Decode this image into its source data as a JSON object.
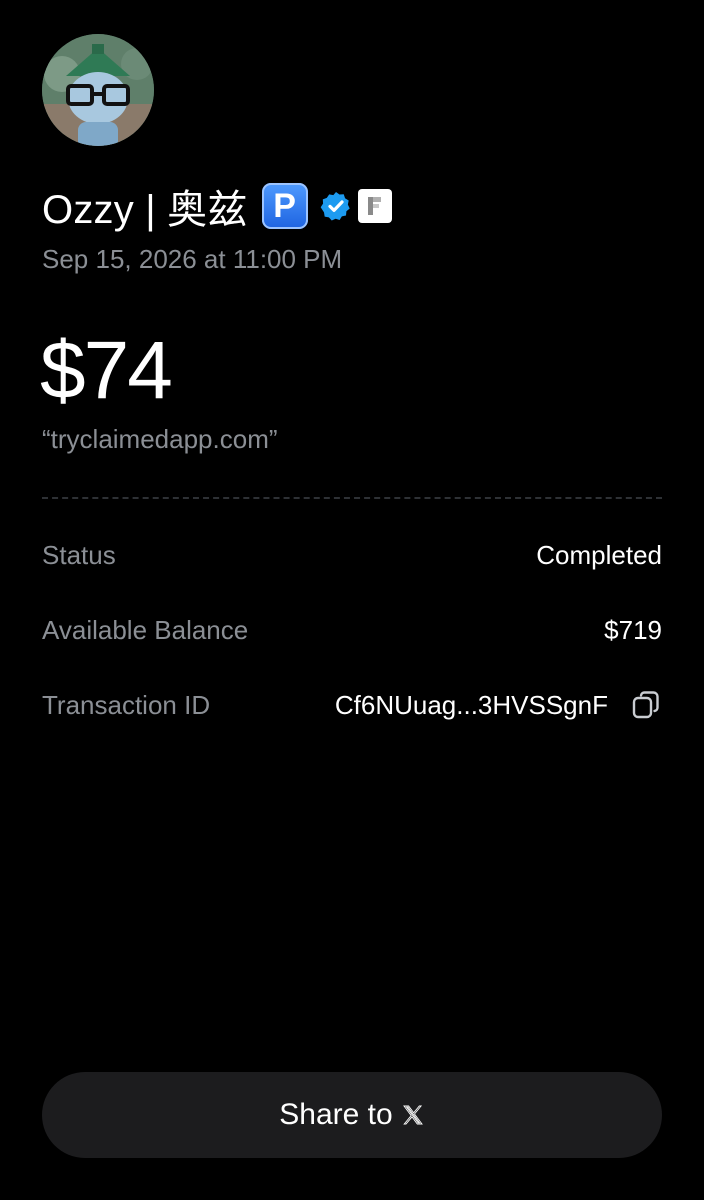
{
  "profile": {
    "name": "Ozzy | 奥兹",
    "parking_badge_letter": "P",
    "verified_icon": "verified-badge-icon",
    "org_badge_icon": "org-logo-icon"
  },
  "transaction": {
    "date": "Sep 15, 2026 at 11:00 PM",
    "amount": "$74",
    "memo": "“tryclaimedapp.com”"
  },
  "details": {
    "status_label": "Status",
    "status_value": "Completed",
    "balance_label": "Available Balance",
    "balance_value": "$719",
    "txid_label": "Transaction ID",
    "txid_value": "Cf6NUuag...3HVSSgnF"
  },
  "share": {
    "label": "Share to",
    "icon": "x-logo-icon"
  },
  "colors": {
    "background": "#000000",
    "secondary_text": "#8b8f95",
    "button_bg": "#1c1c1e",
    "verified_blue": "#1d9bf0"
  }
}
